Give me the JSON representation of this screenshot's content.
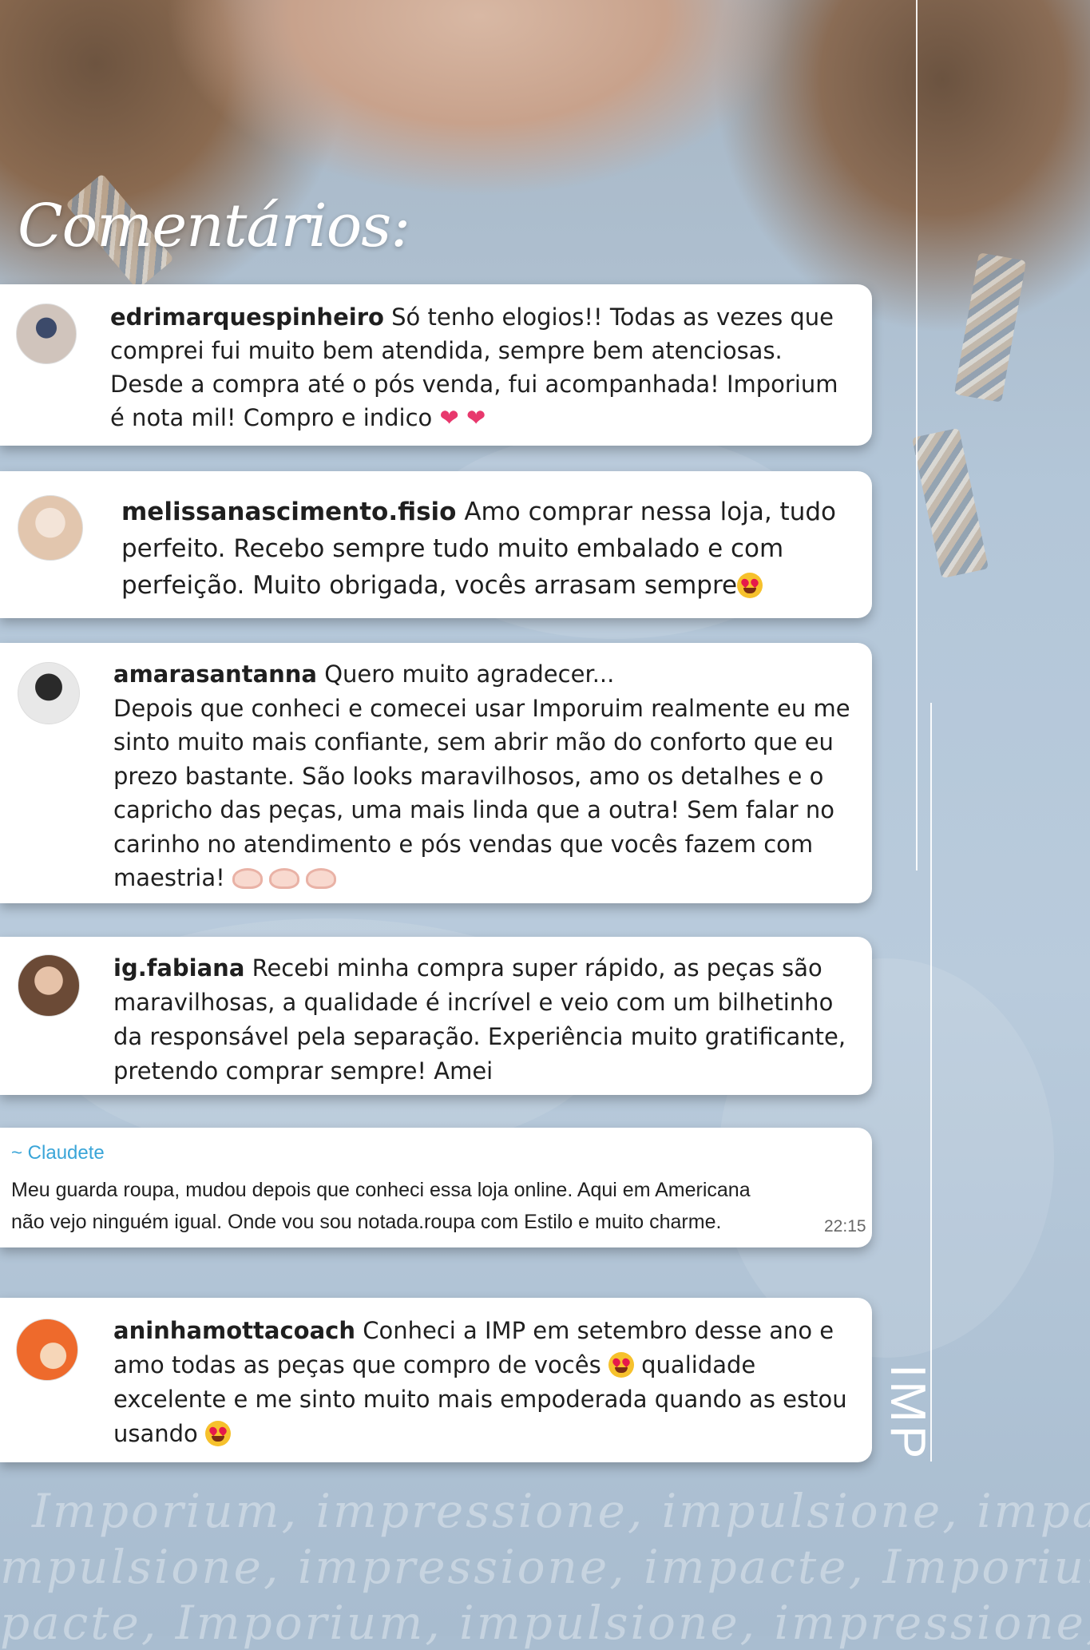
{
  "heading": "Comentários:",
  "comments": [
    {
      "username": "edrimarquespinheiro",
      "text_lines": [
        " Só tenho elogios!! Todas as vezes que",
        "comprei fui muito bem atendida, sempre bem atenciosas.",
        "Desde a compra até o pós venda, fui acompanhada! Imporium",
        "é nota mil! Compro e indico"
      ],
      "emoji": "heart-emoji"
    },
    {
      "username": "melissanascimento.fisio",
      "text_lines": [
        " Amo comprar nessa loja, tudo",
        "perfeito. Recebo sempre tudo muito embalado e com",
        "perfeição. Muito obrigada, vocês arrasam sempre"
      ],
      "emoji": "heart-eyes-emoji"
    },
    {
      "username": "amarasantanna",
      "text_lines": [
        " Quero muito agradecer...",
        "Depois que conheci e comecei usar Imporuim realmente eu me",
        "sinto muito mais confiante, sem abrir mão do conforto que eu",
        "prezo bastante. São looks maravilhosos, amo os detalhes e o",
        "capricho das peças, uma mais linda que a outra! Sem falar no",
        "carinho no atendimento e pós vendas que vocês fazem com",
        "maestria!"
      ],
      "emoji": "heart-hands-emoji"
    },
    {
      "username": "ig.fabiana",
      "text_lines": [
        " Recebi minha compra super rápido, as peças são",
        "maravilhosas, a qualidade é incrível e veio com um bilhetinho",
        "da responsável pela separação. Experiência muito gratificante,",
        "pretendo comprar sempre! Amei"
      ]
    },
    {
      "username": "aninhamottacoach",
      "text_lines": [
        " Conheci a IMP em setembro desse ano e",
        "amo todas as peças que compro de vocês",
        "excelente e me sinto muito mais empoderada quando as estou",
        "usando"
      ],
      "line2_tail": " qualidade",
      "emoji": "heart-eyes-emoji"
    }
  ],
  "whatsapp": {
    "sender": "~ Claudete",
    "text_lines": [
      "Meu guarda roupa, mudou depois que conheci essa loja online. Aqui em Americana",
      "não vejo ninguém igual. Onde vou sou notada.roupa com Estilo e muito charme."
    ],
    "time": "22:15"
  },
  "brand": "IMP",
  "watermark": [
    "Imporium, impressione, impulsione, impacte",
    "mpulsione, impressione, impacte, Imporium",
    "pacte, Imporium, impulsione, impressione, I"
  ]
}
